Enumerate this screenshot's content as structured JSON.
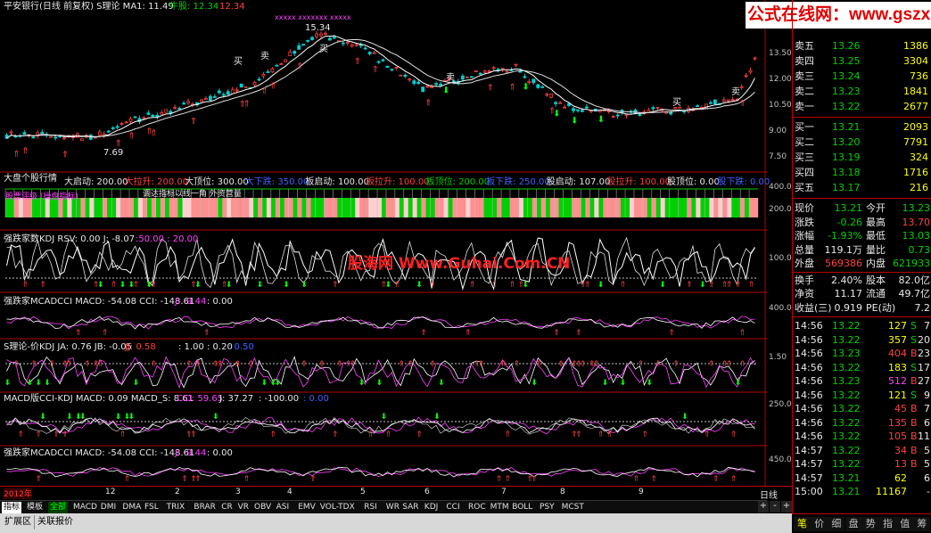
{
  "watermark": "公式在线网：www.gszx.com.cn",
  "main_panel": {
    "title": "平安银行(日线 前复权) S理论 MA1: 11.49",
    "l1": "牛股: 12.34",
    "l2": "12.34",
    "marks": "xxxxx xxxxxxx xxxxx",
    "high": "15.34",
    "low": "7.69",
    "buy": "买",
    "sell": "卖",
    "axis": [
      "13.50",
      "12.00",
      "10.50",
      "9.00",
      "7.50"
    ]
  },
  "panel2": {
    "title": "大盘个股行情",
    "items": [
      {
        "t": "大启动: 200.00",
        "c": "#e8e8e8"
      },
      {
        "t": "大拉升: 200.00",
        "c": "#ff4040"
      },
      {
        "t": "大顶位: 300.00",
        "c": "#e8e8e8"
      },
      {
        "t": "大下跌: 350.00",
        "c": "#4060ff"
      },
      {
        "t": "板启动: 100.00",
        "c": "#e8e8e8"
      },
      {
        "t": "板拉升: 100.00",
        "c": "#ff4040"
      },
      {
        "t": "板顶位: 200.00",
        "c": "#00d000"
      },
      {
        "t": "板下跌: 250.00",
        "c": "#4060ff"
      },
      {
        "t": "股启动: 107.00",
        "c": "#e8e8e8"
      },
      {
        "t": "股拉升: 100.00",
        "c": "#ff4040"
      },
      {
        "t": "股顶位: 0.00",
        "c": "#e8e8e8"
      },
      {
        "t": "股下跌: 0.00",
        "c": "#4060ff"
      }
    ],
    "inner_text": "股票评级 (操盘指标)",
    "inner_text2": "调达指标以线一角 外资营量",
    "axis": [
      "400.0",
      "200.0"
    ]
  },
  "panel3": {
    "title": "强跌家数KDJ RSV: 0.00 J: -8.07",
    "extra": ":50.00 : 20.00",
    "center_wm": "股海网 Www.Guhai.Com.CN",
    "axis": [
      "100.0"
    ]
  },
  "panel4": {
    "title": "强跌家MCADCCI MACD: -54.08 CCI: -148.61",
    "j": "J: -9.44",
    "x": ": 0.00",
    "axis": [
      "400.0"
    ]
  },
  "panel5": {
    "title": "S理论-价KDJ JA: 0.76 JB: -0.05",
    "jj": "JJ: 0.58",
    "x": ": 1.00 : 0.20",
    "x2": ": 0.50",
    "axis": [
      "1.50"
    ]
  },
  "panel6": {
    "title": "MACD版CCI-KDJ MACD: 0.09 MACD_S: 8.61",
    "cci": "CCI: 59.65",
    "j": "J: 37.27",
    "x": ": -100.00",
    "x2": ": 0.00",
    "axis": [
      "250.0"
    ]
  },
  "panel7": {
    "title": "强跌家MCADCCI MACD: -54.08 CCI: -148.61",
    "j": "J: -9.44",
    "x": ": 0.00",
    "axis": [
      "450.0"
    ]
  },
  "timebar": {
    "year": "2012年",
    "months": [
      "12",
      "2",
      "3",
      "4",
      "5",
      "6",
      "7",
      "8",
      "9"
    ],
    "period": "日线"
  },
  "tabs": [
    "指标",
    "模板",
    "全部",
    "MACD",
    "DMI",
    "DMA",
    "FSL",
    "TRIX",
    "BRAR",
    "CR",
    "VR",
    "OBV",
    "ASI",
    "EMV",
    "VOL-TDX",
    "RSI",
    "WR",
    "SAR",
    "KDJ",
    "CCI",
    "ROC",
    "MTM",
    "BOLL",
    "PSY",
    "MCST"
  ],
  "bottom": [
    "扩展区",
    "关联报价"
  ],
  "nav": [
    "+",
    "-",
    "+"
  ],
  "quote": {
    "sell": [
      {
        "l": "卖五",
        "p": "13.26",
        "v": "1386"
      },
      {
        "l": "卖四",
        "p": "13.25",
        "v": "3304"
      },
      {
        "l": "卖三",
        "p": "13.24",
        "v": "736"
      },
      {
        "l": "卖二",
        "p": "13.23",
        "v": "1841"
      },
      {
        "l": "卖一",
        "p": "13.22",
        "v": "2677"
      }
    ],
    "buy": [
      {
        "l": "买一",
        "p": "13.21",
        "v": "2093"
      },
      {
        "l": "买二",
        "p": "13.20",
        "v": "7791"
      },
      {
        "l": "买三",
        "p": "13.19",
        "v": "324"
      },
      {
        "l": "买四",
        "p": "13.18",
        "v": "1716"
      },
      {
        "l": "买五",
        "p": "13.17",
        "v": "216"
      }
    ],
    "stats": [
      {
        "a": "现价",
        "b": "13.21",
        "bc": "#00d000",
        "c": "今开",
        "d": "13.23",
        "dc": "#00d000"
      },
      {
        "a": "涨跌",
        "b": "-0.26",
        "bc": "#00d000",
        "c": "最高",
        "d": "13.70",
        "dc": "#ff4040"
      },
      {
        "a": "涨幅",
        "b": "-1.93%",
        "bc": "#00d000",
        "c": "最低",
        "d": "13.03",
        "dc": "#00d000"
      },
      {
        "a": "总量",
        "b": "119.1万",
        "bc": "#e8e8e8",
        "c": "量比",
        "d": "0.73",
        "dc": "#00d000"
      },
      {
        "a": "外盘",
        "b": "569386",
        "bc": "#ff4040",
        "c": "内盘",
        "d": "621933",
        "dc": "#00d000"
      },
      {
        "a": "换手",
        "b": "2.40%",
        "bc": "#e8e8e8",
        "c": "股本",
        "d": "82.0亿",
        "dc": "#e8e8e8"
      },
      {
        "a": "净资",
        "b": "11.17",
        "bc": "#e8e8e8",
        "c": "流通",
        "d": "49.7亿",
        "dc": "#e8e8e8"
      },
      {
        "a": "收益(三)",
        "b": "0.919",
        "bc": "#e8e8e8",
        "c": "PE(动)",
        "d": "7.2",
        "dc": "#e8e8e8"
      }
    ],
    "ticks": [
      {
        "t": "14:56",
        "p": "13.22",
        "v": "127",
        "s": "S",
        "n": "7"
      },
      {
        "t": "14:56",
        "p": "13.22",
        "v": "357",
        "s": "S",
        "n": "20"
      },
      {
        "t": "14:56",
        "p": "13.23",
        "v": "404",
        "s": "B",
        "n": "23"
      },
      {
        "t": "14:56",
        "p": "13.22",
        "v": "183",
        "s": "S",
        "n": "17"
      },
      {
        "t": "14:56",
        "p": "13.23",
        "v": "512",
        "s": "B",
        "n": "27"
      },
      {
        "t": "14:56",
        "p": "13.22",
        "v": "121",
        "s": "S",
        "n": "9"
      },
      {
        "t": "14:56",
        "p": "13.22",
        "v": "45",
        "s": "B",
        "n": "7"
      },
      {
        "t": "14:56",
        "p": "13.22",
        "v": "135",
        "s": "B",
        "n": "6"
      },
      {
        "t": "14:56",
        "p": "13.22",
        "v": "105",
        "s": "B",
        "n": "11"
      },
      {
        "t": "14:57",
        "p": "13.22",
        "v": "34",
        "s": "B",
        "n": "5"
      },
      {
        "t": "14:57",
        "p": "13.22",
        "v": "13",
        "s": "B",
        "n": "5"
      },
      {
        "t": "14:57",
        "p": "13.21",
        "v": "62",
        "s": "",
        "n": "6"
      },
      {
        "t": "15:00",
        "p": "13.21",
        "v": "11167",
        "s": "",
        "n": "-"
      }
    ]
  },
  "qtabs": [
    "笔",
    "价",
    "细",
    "盘",
    "势",
    "指",
    "值",
    "筹"
  ],
  "colors": {
    "up": "#ff4040",
    "down": "#00d000",
    "frame": "#b00000",
    "bg": "#000000"
  }
}
